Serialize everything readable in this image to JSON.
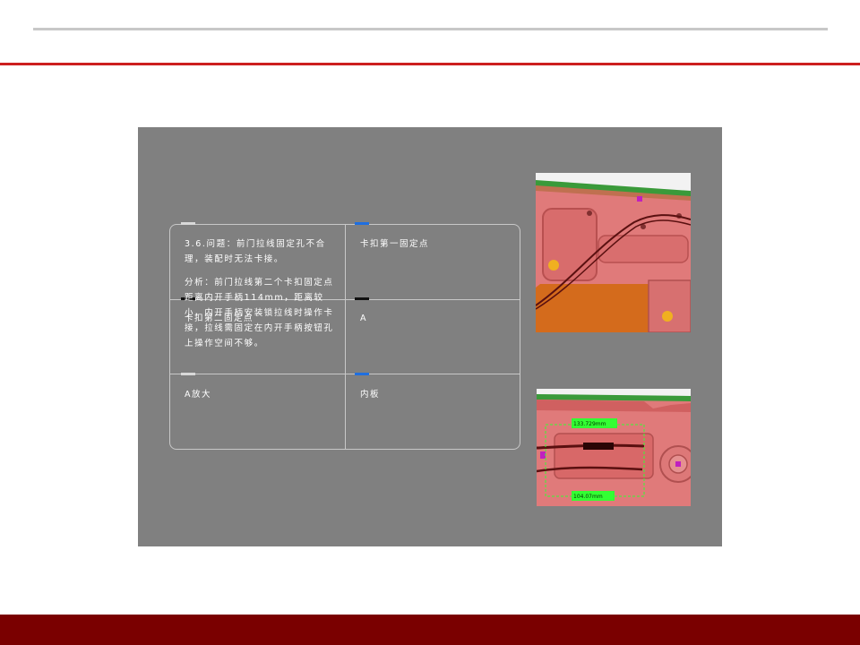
{
  "slide": {
    "problem_heading": "3.6.问题：前门拉线固定孔不合理，装配时无法卡接。",
    "analysis_text": "分析：前门拉线第二个卡扣固定点距离内开手柄114mm，距离较小，内开手柄安装锁拉线时操作卡接，拉线需固定在内开手柄按钮孔上操作空间不够。",
    "overlap_label": "卡扣第二固定点",
    "table": {
      "r1c2": "卡扣第一固定点",
      "r2c2": "A",
      "r3c1": "A放大",
      "r3c2": "内板"
    },
    "image_labels": {
      "dim_top": "133.729mm",
      "dim_bottom": "104.07mm"
    }
  },
  "colors": {
    "accent_red": "#cc1f1f",
    "footer_dark_red": "#7a0000",
    "panel_gray": "#808080",
    "door_pink": "#e07a7a",
    "callout_green": "#33ff33"
  }
}
